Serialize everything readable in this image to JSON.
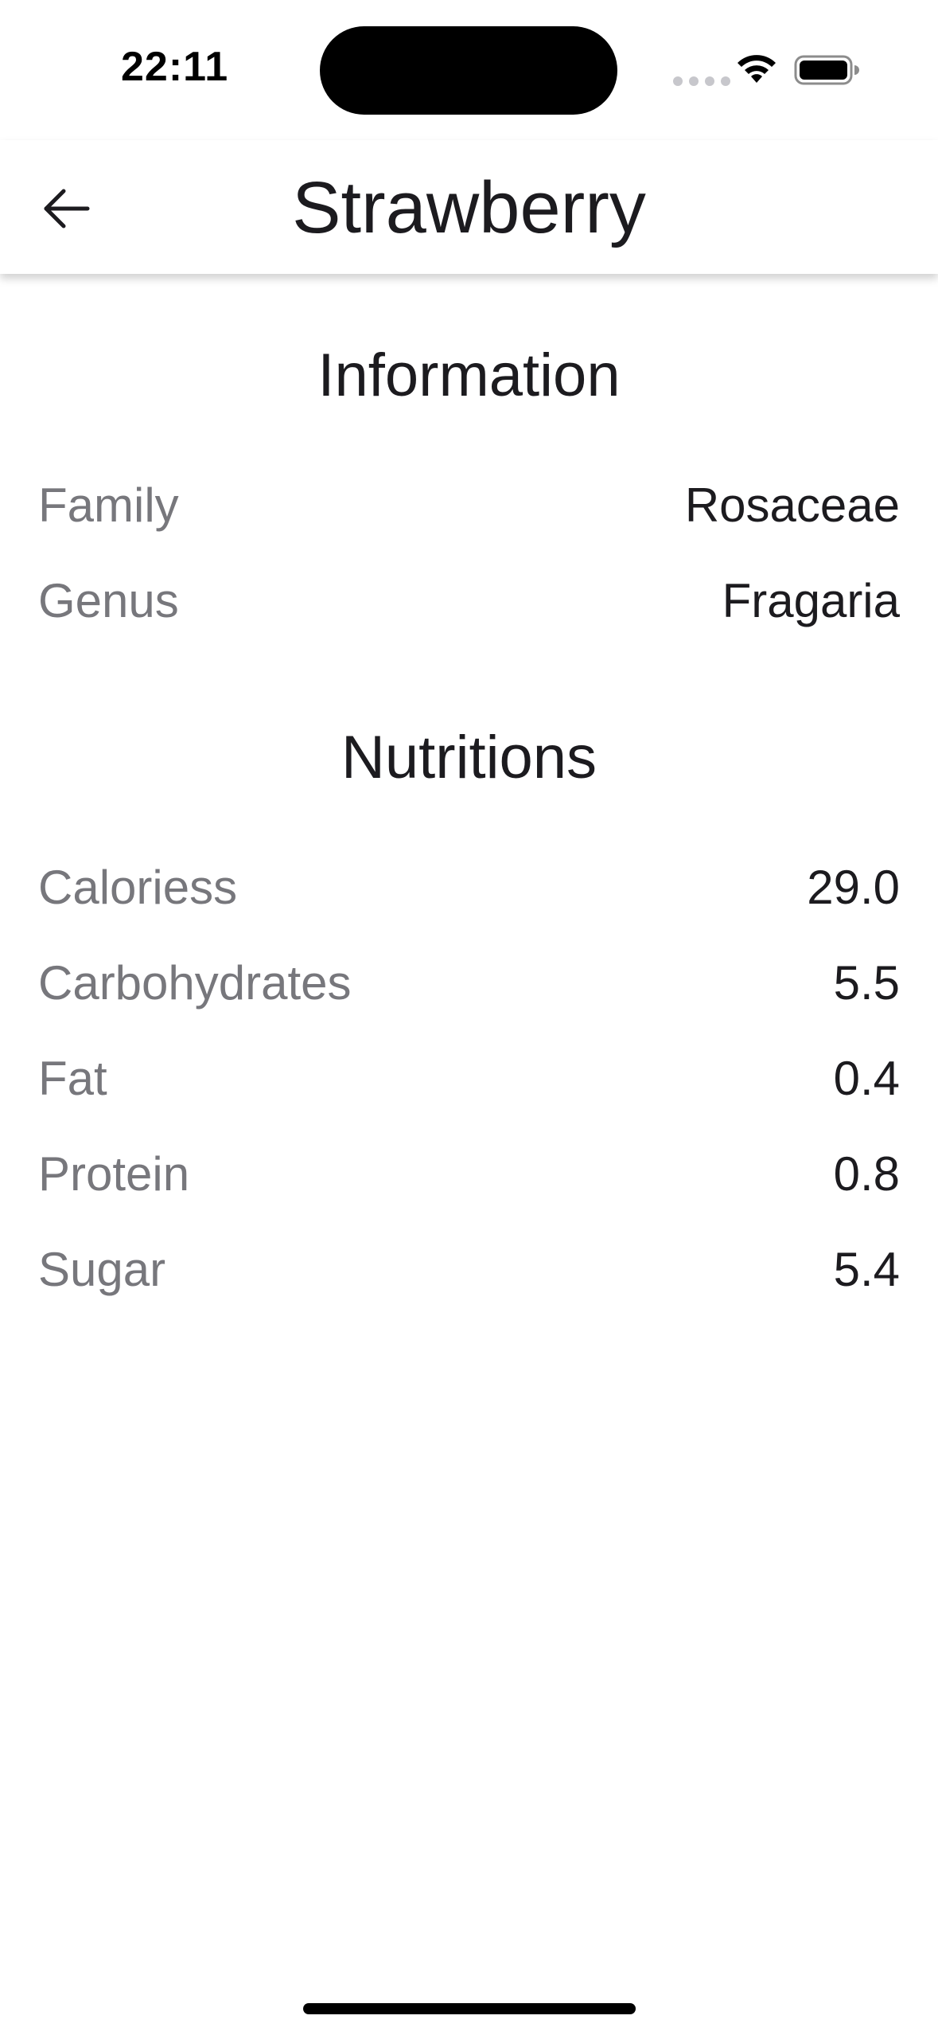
{
  "status_bar": {
    "time": "22:11"
  },
  "app_bar": {
    "title": "Strawberry",
    "back_icon": "arrow-left-icon"
  },
  "information": {
    "title": "Information",
    "rows": [
      {
        "label": "Family",
        "value": "Rosaceae"
      },
      {
        "label": "Genus",
        "value": "Fragaria"
      }
    ]
  },
  "nutritions": {
    "title": "Nutritions",
    "rows": [
      {
        "label": "Caloriess",
        "value": "29.0"
      },
      {
        "label": "Carbohydrates",
        "value": "5.5"
      },
      {
        "label": "Fat",
        "value": "0.4"
      },
      {
        "label": "Protein",
        "value": "0.8"
      },
      {
        "label": "Sugar",
        "value": "5.4"
      }
    ]
  },
  "colors": {
    "label_gray": "#77777c",
    "value_text": "#1c1b1f",
    "background": "#ffffff"
  }
}
